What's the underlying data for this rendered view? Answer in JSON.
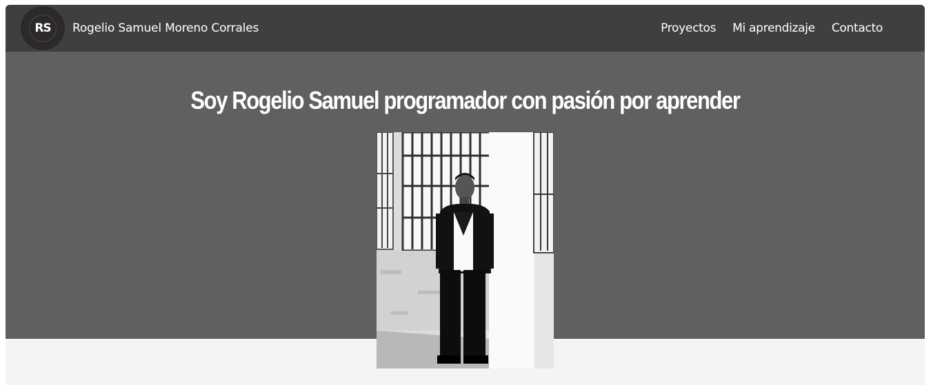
{
  "header": {
    "logo_text": "RS",
    "site_name": "Rogelio Samuel Moreno Corrales",
    "nav": [
      {
        "label": "Proyectos"
      },
      {
        "label": "Mi aprendizaje"
      },
      {
        "label": "Contacto"
      }
    ]
  },
  "hero": {
    "title": "Soy Rogelio Samuel programador con pasión por aprender"
  },
  "colors": {
    "navbar_bg": "#3f3f3f",
    "hero_bg": "#606060",
    "page_bg": "#f4f4f4",
    "text": "#ffffff"
  },
  "icons": {
    "logo": "rs-monogram-logo",
    "photo": "profile-photo"
  }
}
